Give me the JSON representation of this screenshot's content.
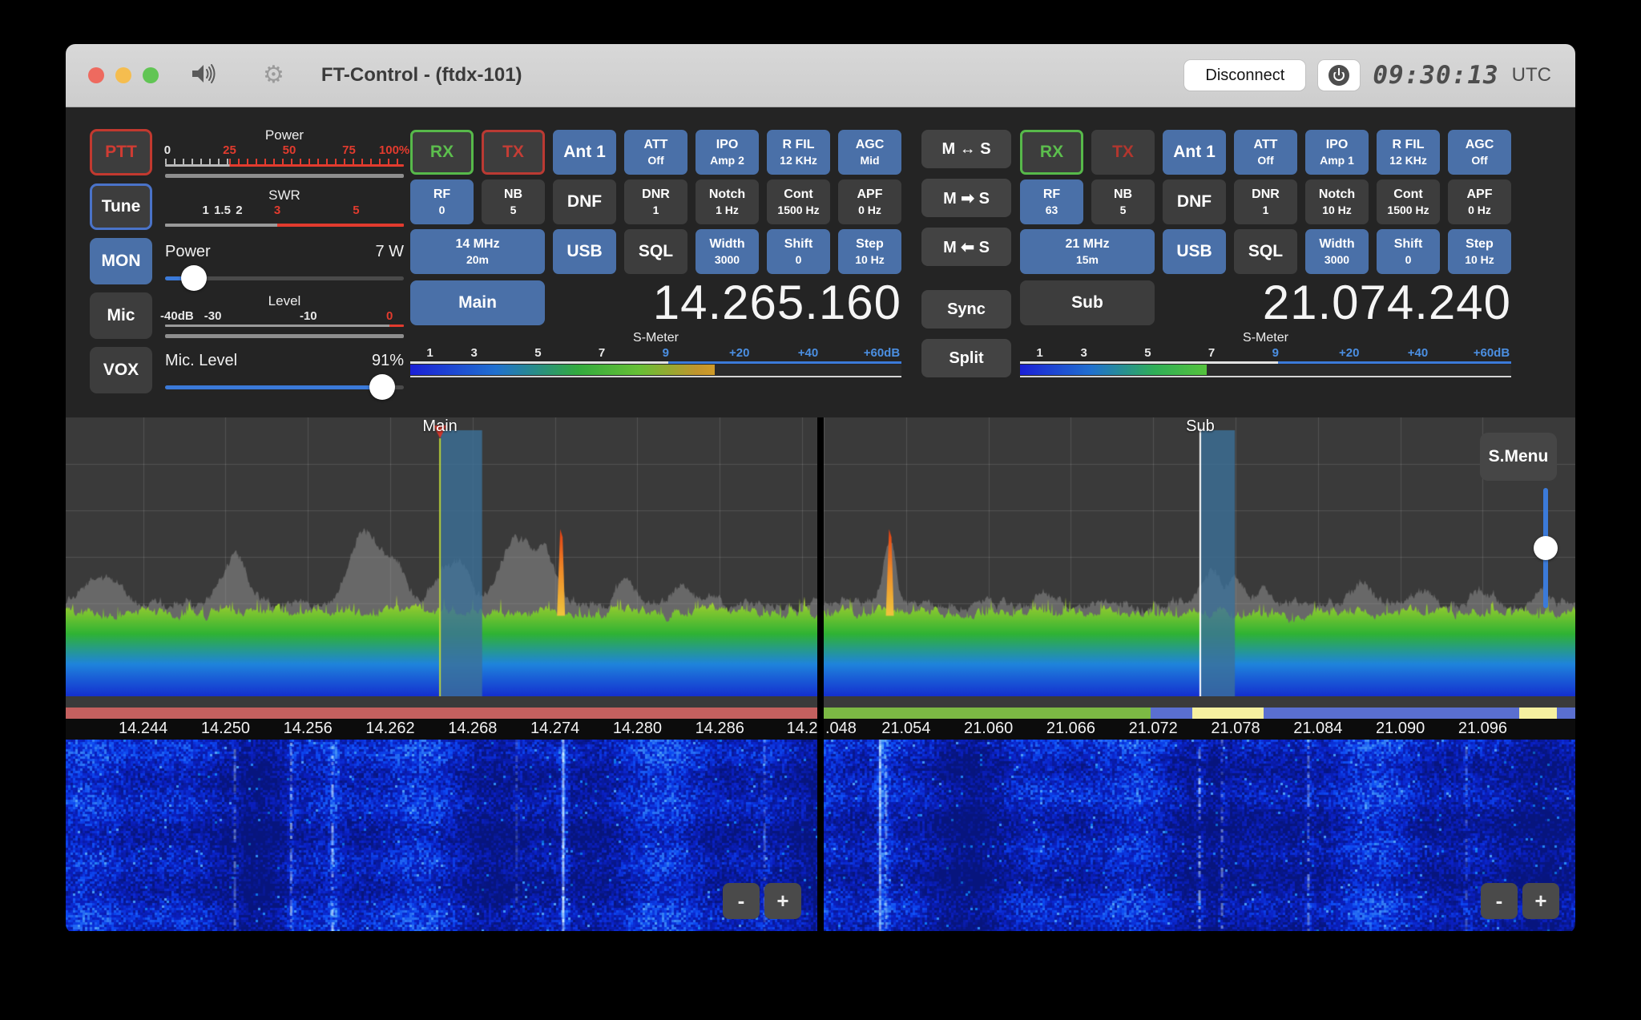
{
  "titlebar": {
    "title": "FT-Control - (ftdx-101)",
    "disconnect": "Disconnect",
    "clock": "09:30:13",
    "timezone": "UTC",
    "traffic_colors": [
      "#ee6a5f",
      "#f5bd4f",
      "#61c554"
    ]
  },
  "left_panel": {
    "ptt": "PTT",
    "tune": "Tune",
    "mon": "MON",
    "mic": "Mic",
    "vox": "VOX",
    "power_meter": {
      "title": "Power",
      "split_percent": 27,
      "labels": [
        {
          "text": "0",
          "pos": 1,
          "color": "white"
        },
        {
          "text": "25",
          "pos": 27,
          "color": "red"
        },
        {
          "text": "50",
          "pos": 52,
          "color": "red"
        },
        {
          "text": "75",
          "pos": 77,
          "color": "red"
        },
        {
          "text": "100%",
          "pos": 96,
          "color": "red"
        }
      ]
    },
    "swr_meter": {
      "title": "SWR",
      "split_percent": 47,
      "labels": [
        {
          "text": "1",
          "pos": 17,
          "color": "white"
        },
        {
          "text": "1.5",
          "pos": 24,
          "color": "white"
        },
        {
          "text": "2",
          "pos": 31,
          "color": "white"
        },
        {
          "text": "3",
          "pos": 47,
          "color": "red"
        },
        {
          "text": "5",
          "pos": 80,
          "color": "red"
        }
      ]
    },
    "power_row": {
      "label": "Power",
      "value": "7 W",
      "percent": 12
    },
    "level_meter": {
      "title": "Level",
      "split_percent": 94,
      "labels": [
        {
          "text": "-40dB",
          "pos": 5,
          "color": "white"
        },
        {
          "text": "-30",
          "pos": 20,
          "color": "white"
        },
        {
          "text": "-10",
          "pos": 60,
          "color": "white"
        },
        {
          "text": "0",
          "pos": 94,
          "color": "red"
        }
      ]
    },
    "mic_row": {
      "label": "Mic. Level",
      "value": "91%",
      "percent": 91
    }
  },
  "transfer_buttons": [
    {
      "name": "main-swap-sub",
      "label": "M ↔ S",
      "gap": false
    },
    {
      "name": "main-to-sub",
      "label": "M ➡ S",
      "gap": false
    },
    {
      "name": "sub-to-main",
      "label": "M ⬅ S",
      "gap": false
    },
    {
      "name": "sync",
      "label": "Sync",
      "gap": true
    },
    {
      "name": "split",
      "label": "Split",
      "gap": false
    }
  ],
  "vfos": [
    {
      "id": "main",
      "rows": [
        [
          {
            "name": "rx",
            "label": "RX",
            "style": "rx single"
          },
          {
            "name": "tx",
            "label": "TX",
            "style": "tx-armed single"
          },
          {
            "name": "antenna",
            "label": "Ant 1",
            "style": "blue single"
          },
          {
            "name": "att",
            "label": "ATT",
            "sub": "Off",
            "style": "blue"
          },
          {
            "name": "ipo",
            "label": "IPO",
            "sub": "Amp 2",
            "style": "blue"
          },
          {
            "name": "roofing-filter",
            "label": "R FIL",
            "sub": "12 KHz",
            "style": "blue"
          },
          {
            "name": "agc",
            "label": "AGC",
            "sub": "Mid",
            "style": "blue"
          }
        ],
        [
          {
            "name": "rf-gain",
            "label": "RF",
            "sub": "0",
            "style": "blue"
          },
          {
            "name": "noise-blanker",
            "label": "NB",
            "sub": "5",
            "style": "dark"
          },
          {
            "name": "dnf",
            "label": "DNF",
            "style": "dark single"
          },
          {
            "name": "dnr",
            "label": "DNR",
            "sub": "1",
            "style": "dark"
          },
          {
            "name": "notch",
            "label": "Notch",
            "sub": "1 Hz",
            "style": "dark"
          },
          {
            "name": "contour",
            "label": "Cont",
            "sub": "1500 Hz",
            "style": "dark"
          },
          {
            "name": "apf",
            "label": "APF",
            "sub": "0 Hz",
            "style": "dark"
          }
        ],
        [
          {
            "name": "band",
            "label": "14 MHz",
            "sub": "20m",
            "style": "blue",
            "span": 2
          },
          {
            "name": "mode",
            "label": "USB",
            "style": "blue single"
          },
          {
            "name": "squelch",
            "label": "SQL",
            "style": "dark single"
          },
          {
            "name": "width",
            "label": "Width",
            "sub": "3000",
            "style": "blue"
          },
          {
            "name": "shift",
            "label": "Shift",
            "sub": "0",
            "style": "blue"
          },
          {
            "name": "step",
            "label": "Step",
            "sub": "10 Hz",
            "style": "blue"
          }
        ]
      ],
      "vfo_label": "Main",
      "vfo_style": "blue",
      "frequency": "14.265.160",
      "smeter": {
        "title": "S-Meter",
        "ticks": [
          {
            "text": "1",
            "color": "white"
          },
          {
            "text": "3",
            "color": "white"
          },
          {
            "text": "5",
            "color": "white"
          },
          {
            "text": "7",
            "color": "white"
          },
          {
            "text": "9",
            "color": "blue"
          },
          {
            "text": "+20",
            "color": "blue"
          },
          {
            "text": "+40",
            "color": "blue"
          },
          {
            "text": "+60dB",
            "color": "blue"
          }
        ],
        "fill_percent": 62
      }
    },
    {
      "id": "sub",
      "rows": [
        [
          {
            "name": "rx",
            "label": "RX",
            "style": "rx single"
          },
          {
            "name": "tx",
            "label": "TX",
            "style": "tx-idle single"
          },
          {
            "name": "antenna",
            "label": "Ant 1",
            "style": "blue single"
          },
          {
            "name": "att",
            "label": "ATT",
            "sub": "Off",
            "style": "blue"
          },
          {
            "name": "ipo",
            "label": "IPO",
            "sub": "Amp 1",
            "style": "blue"
          },
          {
            "name": "roofing-filter",
            "label": "R FIL",
            "sub": "12 KHz",
            "style": "blue"
          },
          {
            "name": "agc",
            "label": "AGC",
            "sub": "Off",
            "style": "blue"
          }
        ],
        [
          {
            "name": "rf-gain",
            "label": "RF",
            "sub": "63",
            "style": "blue"
          },
          {
            "name": "noise-blanker",
            "label": "NB",
            "sub": "5",
            "style": "dark"
          },
          {
            "name": "dnf",
            "label": "DNF",
            "style": "dark single"
          },
          {
            "name": "dnr",
            "label": "DNR",
            "sub": "1",
            "style": "dark"
          },
          {
            "name": "notch",
            "label": "Notch",
            "sub": "10 Hz",
            "style": "dark"
          },
          {
            "name": "contour",
            "label": "Cont",
            "sub": "1500 Hz",
            "style": "dark"
          },
          {
            "name": "apf",
            "label": "APF",
            "sub": "0 Hz",
            "style": "dark"
          }
        ],
        [
          {
            "name": "band",
            "label": "21 MHz",
            "sub": "15m",
            "style": "blue",
            "span": 2
          },
          {
            "name": "mode",
            "label": "USB",
            "style": "blue single"
          },
          {
            "name": "squelch",
            "label": "SQL",
            "style": "dark single"
          },
          {
            "name": "width",
            "label": "Width",
            "sub": "3000",
            "style": "blue"
          },
          {
            "name": "shift",
            "label": "Shift",
            "sub": "0",
            "style": "blue"
          },
          {
            "name": "step",
            "label": "Step",
            "sub": "10 Hz",
            "style": "blue"
          }
        ]
      ],
      "vfo_label": "Sub",
      "vfo_style": "dark",
      "frequency": "21.074.240",
      "smeter": {
        "title": "S-Meter",
        "ticks": [
          {
            "text": "1",
            "color": "white"
          },
          {
            "text": "3",
            "color": "white"
          },
          {
            "text": "5",
            "color": "white"
          },
          {
            "text": "7",
            "color": "white"
          },
          {
            "text": "9",
            "color": "blue"
          },
          {
            "text": "+20",
            "color": "blue"
          },
          {
            "text": "+40",
            "color": "blue"
          },
          {
            "text": "+60dB",
            "color": "blue"
          }
        ],
        "fill_percent": 38
      }
    }
  ],
  "spectrum_panels": [
    {
      "id": "main",
      "label": "Main",
      "seed": 13,
      "axis_labels": [
        "14.244",
        "14.250",
        "14.256",
        "14.262",
        "14.268",
        "14.274",
        "14.280",
        "14.286",
        "14.2"
      ],
      "axis_start": 0.103,
      "axis_step": 0.1096,
      "first_label_flush": false,
      "marker": {
        "frac": 0.498,
        "color": "#b9d33c",
        "triangle": true
      },
      "passband_frac": 0.055,
      "floor_frac": 0.7,
      "humps": [
        {
          "frac": 0.055,
          "h": 0.1,
          "w": 0.02
        },
        {
          "frac": 0.225,
          "h": 0.16,
          "w": 0.018
        },
        {
          "frac": 0.4,
          "h": 0.26,
          "w": 0.022
        },
        {
          "frac": 0.44,
          "h": 0.13,
          "w": 0.012
        },
        {
          "frac": 0.505,
          "h": 0.14,
          "w": 0.014
        },
        {
          "frac": 0.53,
          "h": 0.1,
          "w": 0.01
        },
        {
          "frac": 0.6,
          "h": 0.24,
          "w": 0.02
        },
        {
          "frac": 0.64,
          "h": 0.16,
          "w": 0.012
        },
        {
          "frac": 0.745,
          "h": 0.09,
          "w": 0.012
        },
        {
          "frac": 0.82,
          "h": 0.05,
          "w": 0.015
        }
      ],
      "spikes": [
        {
          "frac": 0.659,
          "h": 0.3
        }
      ],
      "bottom_segments": [
        {
          "from": 0,
          "to": 1,
          "color": "#c4605f"
        }
      ],
      "waterfall_streaks": [
        {
          "frac": 0.225,
          "s": 0.45,
          "dash": true
        },
        {
          "frac": 0.3,
          "s": 0.6,
          "dash": true
        },
        {
          "frac": 0.355,
          "s": 0.75,
          "dash": true
        },
        {
          "frac": 0.6,
          "s": 0.25,
          "dash": true
        },
        {
          "frac": 0.662,
          "s": 1.0,
          "dash": false
        },
        {
          "frac": 0.93,
          "s": 0.3,
          "dash": true
        }
      ]
    },
    {
      "id": "sub",
      "label": "Sub",
      "seed": 77,
      "axis_labels": [
        ".048",
        "21.054",
        "21.060",
        "21.066",
        "21.072",
        "21.078",
        "21.084",
        "21.090",
        "21.096"
      ],
      "axis_start": 0.0,
      "axis_step": 0.1096,
      "first_label_flush": true,
      "marker": {
        "frac": 0.501,
        "color": "#ffffff",
        "triangle": false
      },
      "passband_frac": 0.045,
      "floor_frac": 0.7,
      "humps": [
        {
          "frac": 0.088,
          "h": 0.24,
          "w": 0.008
        },
        {
          "frac": 0.3,
          "h": 0.05,
          "w": 0.012
        },
        {
          "frac": 0.515,
          "h": 0.15,
          "w": 0.012
        },
        {
          "frac": 0.55,
          "h": 0.09,
          "w": 0.01
        },
        {
          "frac": 0.585,
          "h": 0.07,
          "w": 0.01
        },
        {
          "frac": 0.72,
          "h": 0.06,
          "w": 0.014
        },
        {
          "frac": 0.8,
          "h": 0.05,
          "w": 0.01
        },
        {
          "frac": 0.88,
          "h": 0.04,
          "w": 0.012
        },
        {
          "frac": 0.955,
          "h": 0.05,
          "w": 0.01
        }
      ],
      "spikes": [
        {
          "frac": 0.088,
          "h": 0.3
        }
      ],
      "bottom_segments": [
        {
          "from": 0,
          "to": 0.435,
          "color": "#7cb944"
        },
        {
          "from": 0.435,
          "to": 1,
          "color": "#5a6fd0"
        },
        {
          "from": 0.49,
          "to": 0.585,
          "color": "#f5f0a0"
        },
        {
          "from": 0.925,
          "to": 0.975,
          "color": "#f5f0a0"
        }
      ],
      "waterfall_streaks": [
        {
          "frac": 0.075,
          "s": 0.9,
          "dash": false
        },
        {
          "frac": 0.083,
          "s": 0.5,
          "dash": true
        },
        {
          "frac": 0.5,
          "s": 0.8,
          "dash": true
        },
        {
          "frac": 0.53,
          "s": 0.45,
          "dash": true
        },
        {
          "frac": 0.645,
          "s": 0.55,
          "dash": true
        },
        {
          "frac": 0.855,
          "s": 0.3,
          "dash": true
        }
      ]
    }
  ],
  "spectrum_controls": {
    "s_menu": "S.Menu",
    "zoom_out": "-",
    "zoom_in": "+"
  }
}
